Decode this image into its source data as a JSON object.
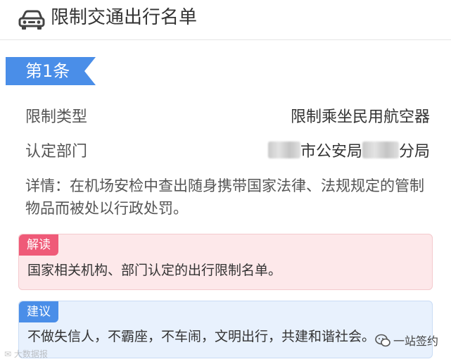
{
  "header": {
    "title": "限制交通出行名单",
    "icon": "car-icon"
  },
  "tag": {
    "label": "第1条"
  },
  "rows": [
    {
      "label": "限制类型",
      "value": "限制乘坐民用航空器"
    },
    {
      "label": "认定部门",
      "value_mid": "市公安局",
      "value_end": "分局"
    }
  ],
  "detail": "详情：在机场安检中查出随身携带国家法律、法规规定的管制物品而被处以行政处罚。",
  "interpretation": {
    "badge": "解读",
    "text": "国家相关机构、部门认定的出行限制名单。"
  },
  "suggestion": {
    "badge": "建议",
    "text": "不做失信人，不霸座，不车闹，文明出行，共建和谐社会。"
  },
  "watermarks": {
    "left": "大数据报",
    "right": "一站签约"
  },
  "colors": {
    "tag": "#4a8ee8",
    "interpret_badge": "#ef5a78",
    "suggest_badge": "#4a8ee8"
  }
}
